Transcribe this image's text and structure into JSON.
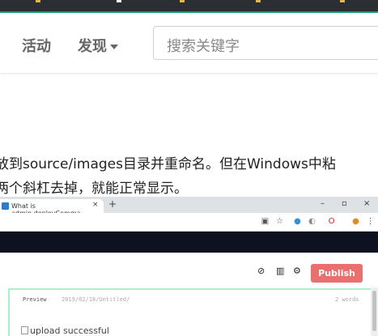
{
  "nav": {
    "activity": "活动",
    "discover": "发现",
    "search_placeholder": "搜索关键字"
  },
  "article": {
    "line1": "放到source/images目录并重命名。但在Windows中粘",
    "line2": "两个斜杠去掉，就能正常显示。"
  },
  "embedded": {
    "tab_title": "What is admin.deployComma",
    "tab_close": "×",
    "new_tab": "+",
    "win_min": "–",
    "win_max": "▫",
    "win_close": "×",
    "publish_label": "Publish",
    "preview_label": "Preview",
    "preview_path": "2019/02/18/Untitled/",
    "preview_words": "2 words",
    "image_alt": "upload successful"
  },
  "colors": {
    "publish": "#ea6f6f",
    "app_header": "#0e1220",
    "accent_line": "#1aa37a",
    "preview_border": "#aaf3c6"
  }
}
